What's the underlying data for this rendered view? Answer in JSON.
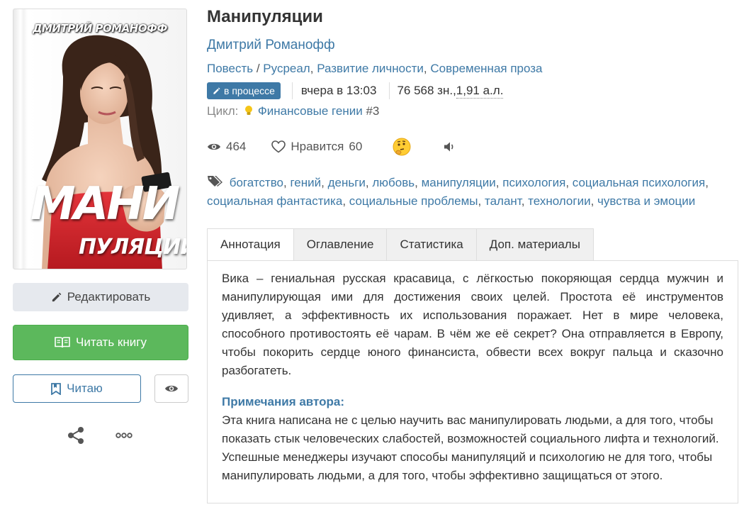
{
  "book": {
    "title": "Манипуляции",
    "author": "Дмитрий Романофф",
    "genres": [
      {
        "label": "Повесть"
      },
      {
        "label": "Русреал"
      },
      {
        "label": "Развитие личности"
      },
      {
        "label": "Современная проза"
      }
    ],
    "genre_separator": " / ",
    "status": "в процессе",
    "updated": "вчера в 13:03",
    "size": "76 568 зн., ",
    "size_sheets": "1,91 а.л.",
    "cycle_label": "Цикл:",
    "cycle_name": "Финансовые гении",
    "cycle_number": "#3"
  },
  "cover": {
    "author_text": "ДМИТРИЙ РОМАНОФФ",
    "title_line1": "МАНИ",
    "title_line2": "ПУЛЯЦИИ"
  },
  "stats": {
    "views": "464",
    "likes_label": "Нравится",
    "likes": "60"
  },
  "tags": [
    "богатство",
    "гений",
    "деньги",
    "любовь",
    "манипуляции",
    "психология",
    "социальная психология",
    "социальная фантастика",
    "социальные проблемы",
    "талант",
    "технологии",
    "чувства и эмоции"
  ],
  "actions": {
    "edit": "Редактировать",
    "read": "Читать книгу",
    "reading": "Читаю"
  },
  "tabs": [
    {
      "label": "Аннотация",
      "active": true
    },
    {
      "label": "Оглавление",
      "active": false
    },
    {
      "label": "Статистика",
      "active": false
    },
    {
      "label": "Доп. материалы",
      "active": false
    }
  ],
  "annotation": "Вика – гениальная русская красавица, с лёгкостью покоряющая сердца мужчин и манипулирующая ими для достижения своих целей. Простота её инструментов удивляет, а эффективность их использования поражает. Нет в мире человека, способного противостоять её чарам. В чём же её секрет? Она отправляется в Европу, чтобы покорить сердце юного финансиста, обвести всех вокруг пальца и сказочно разбогатеть.",
  "notes_title": "Примечания автора:",
  "notes": "Эта книга написана не с целью научить вас манипулировать людьми, а для того, чтобы показать стык человеческих слабостей, возможностей социального лифта и технологий. Успешные менеджеры изучают способы манипуляций и психологию не для того, чтобы манипулировать людьми, а для того, чтобы эффективно защищаться от этого.",
  "colors": {
    "link": "#3e79a6",
    "read_button": "#5cb85c",
    "cover_dress": "#d8262a"
  },
  "icons": {
    "pencil": "pencil-icon",
    "book": "open-book-icon",
    "bookmark": "bookmark-icon",
    "eye": "eye-icon",
    "heart": "heart-icon",
    "share": "share-icon",
    "more": "more-icon",
    "tag": "tag-icon",
    "bulb": "bulb-icon",
    "sound": "speaker-icon",
    "emoji": "thinking-emoji-icon"
  }
}
